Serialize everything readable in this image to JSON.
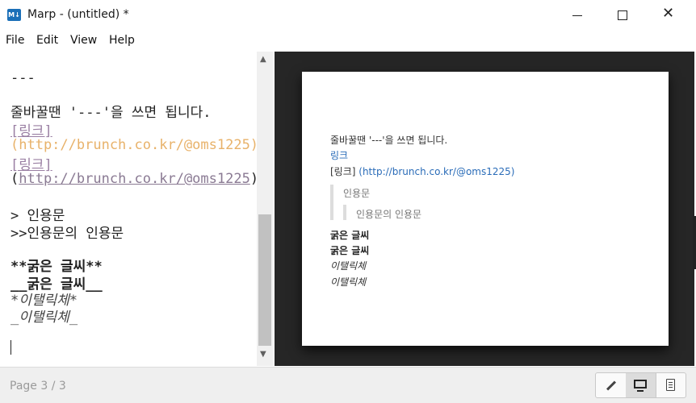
{
  "window": {
    "app_icon_text": "M↓",
    "title": "Marp - (untitled) *"
  },
  "menu": {
    "file": "File",
    "edit": "Edit",
    "view": "View",
    "help": "Help"
  },
  "editor": {
    "lines": {
      "hr": "---",
      "sentence": "줄바꿀땐 '---'을 쓰면 됩니다.",
      "link1_text": "[링크]",
      "link1_url": "(http://brunch.co.kr/@oms1225)",
      "link2_text": "[링크]",
      "paren_open": "(",
      "link2_url": "http://brunch.co.kr/@oms1225",
      "paren_close": ")",
      "quote1": "> 인용문",
      "quote2": ">>인용문의 인용문",
      "bold1": "**굵은 글씨**",
      "bold2": "__굵은 글씨__",
      "italic1": "*이탤릭체*",
      "italic2_prefix": "_",
      "italic2": "이탤릭체",
      "italic2_suffix": "_"
    }
  },
  "preview": {
    "sentence": "줄바꿀땐 '---'을 쓰면 됩니다.",
    "link": "링크",
    "link2_prefix": "[링크] ",
    "link2_url": "(http://brunch.co.kr/@oms1225)",
    "quote1": "인용문",
    "quote2": "인용문의 인용문",
    "bold1": "굵은 글씨",
    "bold2": "굵은 글씨",
    "italic1": "이탤릭체",
    "italic2": "이탤릭체"
  },
  "status": {
    "page": "Page 3 / 3"
  },
  "icons": {
    "edit": "pencil-icon",
    "preview": "monitor-icon",
    "doc": "document-icon"
  }
}
